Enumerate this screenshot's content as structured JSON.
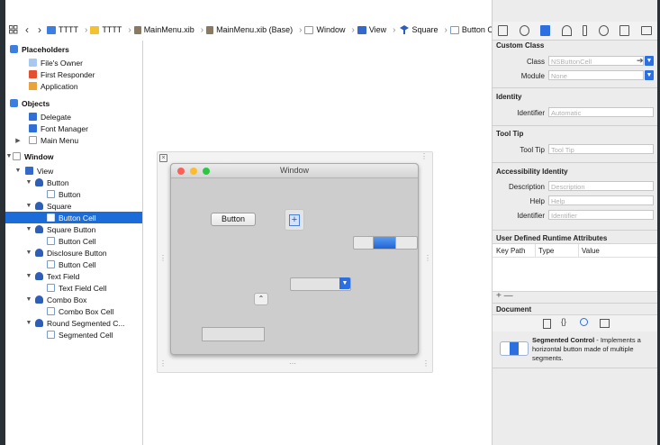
{
  "jumpbar": {
    "items": [
      "TTTT",
      "TTTT",
      "MainMenu.xib",
      "MainMenu.xib (Base)",
      "Window",
      "View",
      "Square",
      "Button Cell"
    ]
  },
  "outline": {
    "placeholders": "Placeholders",
    "files_owner": "File's Owner",
    "first_responder": "First Responder",
    "application": "Application",
    "objects": "Objects",
    "delegate": "Delegate",
    "font_manager": "Font Manager",
    "main_menu": "Main Menu",
    "window": "Window",
    "view": "View",
    "button": "Button",
    "button_child": "Button",
    "square": "Square",
    "button_cell_sel": "Button Cell",
    "square_button": "Square Button",
    "button_cell_2": "Button Cell",
    "disclosure_button": "Disclosure Button",
    "button_cell_3": "Button Cell",
    "text_field": "Text Field",
    "text_field_cell": "Text Field Cell",
    "combo_box": "Combo Box",
    "combo_box_cell": "Combo Box Cell",
    "round_segmented": "Round Segmented C...",
    "segmented_cell": "Segmented Cell"
  },
  "canvas": {
    "window_title": "Window",
    "button_label": "Button",
    "square_glyph": "+"
  },
  "inspector": {
    "custom_class_header": "Custom Class",
    "class_label": "Class",
    "class_placeholder": "NSButtonCell",
    "module_label": "Module",
    "module_placeholder": "None",
    "identity_header": "Identity",
    "identifier_label": "Identifier",
    "identifier_placeholder": "Automatic",
    "tooltip_header": "Tool Tip",
    "tooltip_label": "Tool Tip",
    "tooltip_placeholder": "Tool Tip",
    "access_header": "Accessibility Identity",
    "description_label": "Description",
    "description_placeholder": "Description",
    "help_label": "Help",
    "help_placeholder": "Help",
    "access_identifier_label": "Identifier",
    "access_identifier_placeholder": "Identifier",
    "udra_header": "User Defined Runtime Attributes",
    "col_keypath": "Key Path",
    "col_type": "Type",
    "col_value": "Value",
    "add_remove": "+ —",
    "document_header": "Document",
    "library_title": "Segmented Control",
    "library_desc": " - Implements a horizontal button made of multiple segments."
  },
  "colors": {
    "selection": "#1b6cd8",
    "accent_blue": "#2d6fe0",
    "traffic_red": "#fc5f57",
    "traffic_yellow": "#fdbc2e",
    "traffic_green": "#29c840"
  }
}
